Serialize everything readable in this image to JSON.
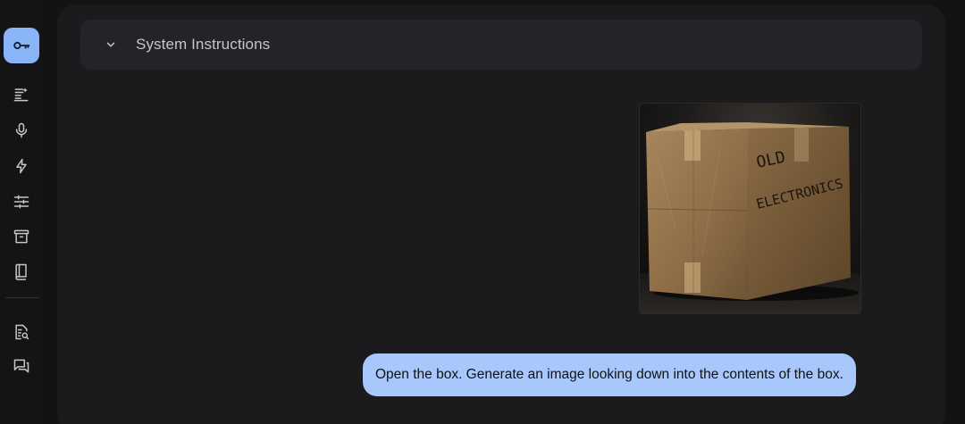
{
  "sidebar": {
    "items": [
      {
        "name": "key-icon",
        "active": true
      },
      {
        "name": "new-prompt-icon"
      },
      {
        "name": "microphone-icon"
      },
      {
        "name": "bolt-icon"
      },
      {
        "name": "tune-icon"
      },
      {
        "name": "archive-icon"
      },
      {
        "name": "book-icon"
      },
      {
        "name": "doc-search-icon"
      },
      {
        "name": "chat-icon"
      }
    ]
  },
  "system_instructions": {
    "title": "System Instructions",
    "expanded": false
  },
  "chat": {
    "image": {
      "description_text": [
        "OLD",
        "ELECTRONICS"
      ]
    },
    "user_message": "Open the box. Generate an image looking down into the contents of the box."
  },
  "colors": {
    "accent": "#8ab4f8",
    "bubble": "#a8c7fa",
    "panel": "#1b1b1e",
    "background": "#131316"
  }
}
